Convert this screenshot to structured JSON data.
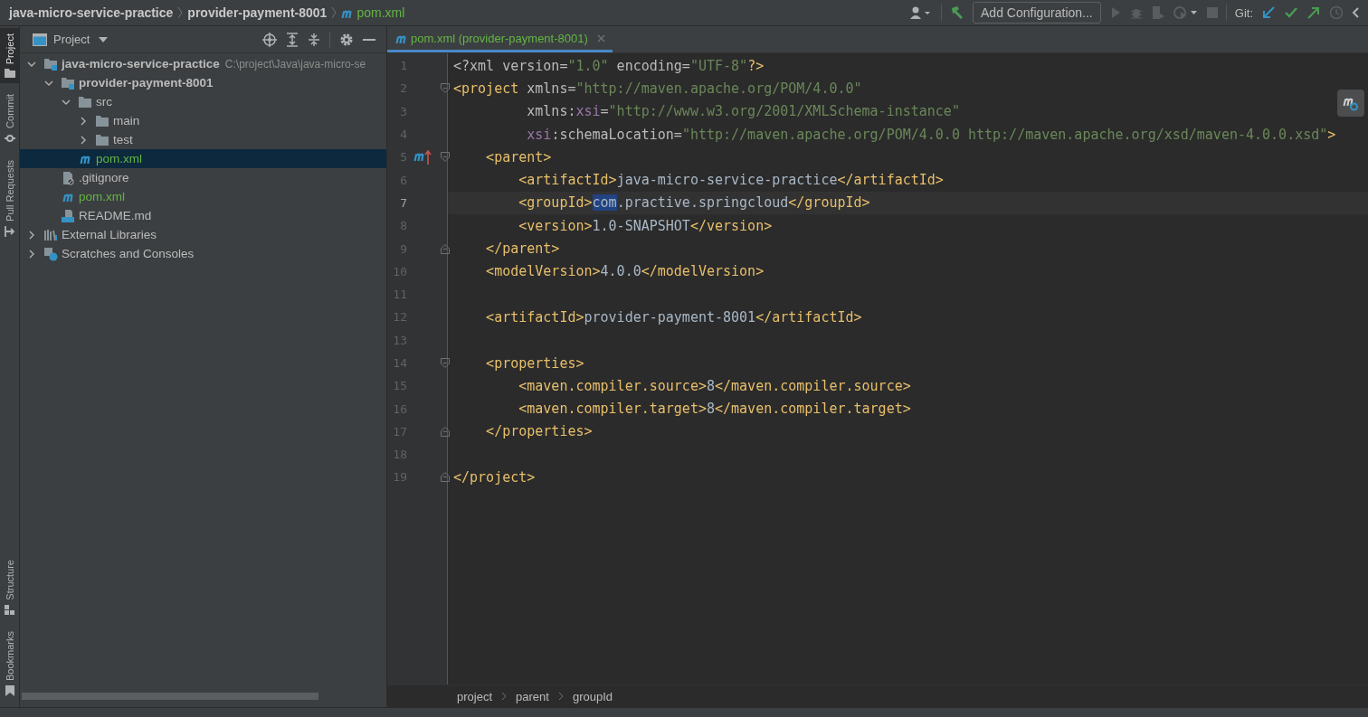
{
  "breadcrumbs": [
    {
      "label": "java-micro-service-practice",
      "kind": "project"
    },
    {
      "label": "provider-payment-8001",
      "kind": "module"
    },
    {
      "label": "pom.xml",
      "kind": "maven"
    }
  ],
  "toolbar": {
    "run_config": "Add Configuration...",
    "git_label": "Git:"
  },
  "tool_stripe": {
    "top": [
      {
        "label": "Project",
        "kind": "folder",
        "selected": true
      },
      {
        "label": "Commit",
        "kind": "commit",
        "selected": false
      },
      {
        "label": "Pull Requests",
        "kind": "pull",
        "selected": false
      }
    ],
    "bottom": [
      {
        "label": "Structure",
        "kind": "structure",
        "selected": false
      },
      {
        "label": "Bookmarks",
        "kind": "bookmark",
        "selected": false
      }
    ]
  },
  "project_panel": {
    "title": "Project",
    "tree": [
      {
        "label": "java-micro-service-practice",
        "hint": "C:\\project\\Java\\java-micro-se",
        "kind": "module",
        "expanded": true,
        "selected": false,
        "added": false,
        "children": [
          {
            "label": "provider-payment-8001",
            "kind": "module",
            "expanded": true,
            "selected": false,
            "added": false,
            "children": [
              {
                "label": "src",
                "kind": "folder",
                "expanded": true,
                "selected": false,
                "added": false,
                "children": [
                  {
                    "label": "main",
                    "kind": "folder",
                    "expanded": false,
                    "selected": false,
                    "added": false
                  },
                  {
                    "label": "test",
                    "kind": "folder",
                    "expanded": false,
                    "selected": false,
                    "added": false
                  }
                ]
              },
              {
                "label": "pom.xml",
                "kind": "maven",
                "selected": true,
                "added": true
              }
            ]
          },
          {
            "label": ".gitignore",
            "kind": "gitignore",
            "selected": false,
            "added": false
          },
          {
            "label": "pom.xml",
            "kind": "maven",
            "selected": false,
            "added": true
          },
          {
            "label": "README.md",
            "kind": "markdown",
            "selected": false,
            "added": false
          }
        ]
      },
      {
        "label": "External Libraries",
        "kind": "libraries",
        "expanded": false,
        "selected": false,
        "added": false
      },
      {
        "label": "Scratches and Consoles",
        "kind": "scratches",
        "expanded": false,
        "selected": false,
        "added": false
      }
    ]
  },
  "editor": {
    "tabs": [
      {
        "label": "pom.xml (provider-payment-8001)",
        "selected": true
      }
    ],
    "lines": [
      {
        "number": "1",
        "current": false,
        "marker": false,
        "fold_start": false,
        "fold_end": false,
        "tokens": [
          {
            "kind": "attr",
            "text": "<?xml version="
          },
          {
            "kind": "str",
            "text": "\"1.0\""
          },
          {
            "kind": "attr",
            "text": " encoding="
          },
          {
            "kind": "str",
            "text": "\"UTF-8\""
          },
          {
            "kind": "tag",
            "text": "?>"
          }
        ]
      },
      {
        "number": "2",
        "current": false,
        "marker": false,
        "fold_start": true,
        "fold_end": false,
        "tokens": [
          {
            "kind": "tag",
            "text": "<project "
          },
          {
            "kind": "attr",
            "text": "xmlns="
          },
          {
            "kind": "str",
            "text": "\"http://maven.apache.org/POM/4.0.0\""
          }
        ]
      },
      {
        "number": "3",
        "current": false,
        "marker": false,
        "fold_start": false,
        "fold_end": false,
        "tokens": [
          {
            "kind": "attr",
            "text": "         xmlns:"
          },
          {
            "kind": "ns",
            "text": "xsi"
          },
          {
            "kind": "attr",
            "text": "="
          },
          {
            "kind": "str",
            "text": "\"http://www.w3.org/2001/XMLSchema-instance\""
          }
        ]
      },
      {
        "number": "4",
        "current": false,
        "marker": false,
        "fold_start": false,
        "fold_end": false,
        "tokens": [
          {
            "kind": "ns",
            "text": "         xsi"
          },
          {
            "kind": "attr",
            "text": ":schemaLocation="
          },
          {
            "kind": "str",
            "text": "\"http://maven.apache.org/POM/4.0.0 http://maven.apache.org/xsd/maven-4.0.0.xsd\""
          },
          {
            "kind": "tag",
            "text": ">"
          }
        ]
      },
      {
        "number": "5",
        "current": false,
        "marker": true,
        "fold_start": true,
        "fold_end": false,
        "tokens": [
          {
            "kind": "tag",
            "text": "    <parent>"
          }
        ]
      },
      {
        "number": "6",
        "current": false,
        "marker": false,
        "fold_start": false,
        "fold_end": false,
        "tokens": [
          {
            "kind": "tag",
            "text": "        <artifactId>"
          },
          {
            "kind": "text",
            "text": "java-micro-service-practice"
          },
          {
            "kind": "tag",
            "text": "</artifactId>"
          }
        ]
      },
      {
        "number": "7",
        "current": true,
        "marker": false,
        "fold_start": false,
        "fold_end": false,
        "tokens": [
          {
            "kind": "tag",
            "text": "        <groupId>"
          },
          {
            "kind": "sel",
            "text": "com"
          },
          {
            "kind": "text",
            "text": ".practive.springcloud"
          },
          {
            "kind": "tag",
            "text": "</groupId>"
          }
        ]
      },
      {
        "number": "8",
        "current": false,
        "marker": false,
        "fold_start": false,
        "fold_end": false,
        "tokens": [
          {
            "kind": "tag",
            "text": "        <version>"
          },
          {
            "kind": "text",
            "text": "1.0-SNAPSHOT"
          },
          {
            "kind": "tag",
            "text": "</version>"
          }
        ]
      },
      {
        "number": "9",
        "current": false,
        "marker": false,
        "fold_start": false,
        "fold_end": true,
        "tokens": [
          {
            "kind": "tag",
            "text": "    </parent>"
          }
        ]
      },
      {
        "number": "10",
        "current": false,
        "marker": false,
        "fold_start": false,
        "fold_end": false,
        "tokens": [
          {
            "kind": "tag",
            "text": "    <modelVersion>"
          },
          {
            "kind": "text",
            "text": "4.0.0"
          },
          {
            "kind": "tag",
            "text": "</modelVersion>"
          }
        ]
      },
      {
        "number": "11",
        "current": false,
        "marker": false,
        "fold_start": false,
        "fold_end": false
      },
      {
        "number": "12",
        "current": false,
        "marker": false,
        "fold_start": false,
        "fold_end": false,
        "tokens": [
          {
            "kind": "tag",
            "text": "    <artifactId>"
          },
          {
            "kind": "text",
            "text": "provider-payment-8001"
          },
          {
            "kind": "tag",
            "text": "</artifactId>"
          }
        ]
      },
      {
        "number": "13",
        "current": false,
        "marker": false,
        "fold_start": false,
        "fold_end": false
      },
      {
        "number": "14",
        "current": false,
        "marker": false,
        "fold_start": true,
        "fold_end": false,
        "tokens": [
          {
            "kind": "tag",
            "text": "    <properties>"
          }
        ]
      },
      {
        "number": "15",
        "current": false,
        "marker": false,
        "fold_start": false,
        "fold_end": false,
        "tokens": [
          {
            "kind": "tag",
            "text": "        <maven.compiler.source>"
          },
          {
            "kind": "text",
            "text": "8"
          },
          {
            "kind": "tag",
            "text": "</maven.compiler.source>"
          }
        ]
      },
      {
        "number": "16",
        "current": false,
        "marker": false,
        "fold_start": false,
        "fold_end": false,
        "tokens": [
          {
            "kind": "tag",
            "text": "        <maven.compiler.target>"
          },
          {
            "kind": "text",
            "text": "8"
          },
          {
            "kind": "tag",
            "text": "</maven.compiler.target>"
          }
        ]
      },
      {
        "number": "17",
        "current": false,
        "marker": false,
        "fold_start": false,
        "fold_end": true,
        "tokens": [
          {
            "kind": "tag",
            "text": "    </properties>"
          }
        ]
      },
      {
        "number": "18",
        "current": false,
        "marker": false,
        "fold_start": false,
        "fold_end": false
      },
      {
        "number": "19",
        "current": false,
        "marker": false,
        "fold_start": false,
        "fold_end": true,
        "tokens": [
          {
            "kind": "tag",
            "text": "</project>"
          }
        ]
      }
    ],
    "breadcrumbs": [
      "project",
      "parent",
      "groupId"
    ]
  }
}
